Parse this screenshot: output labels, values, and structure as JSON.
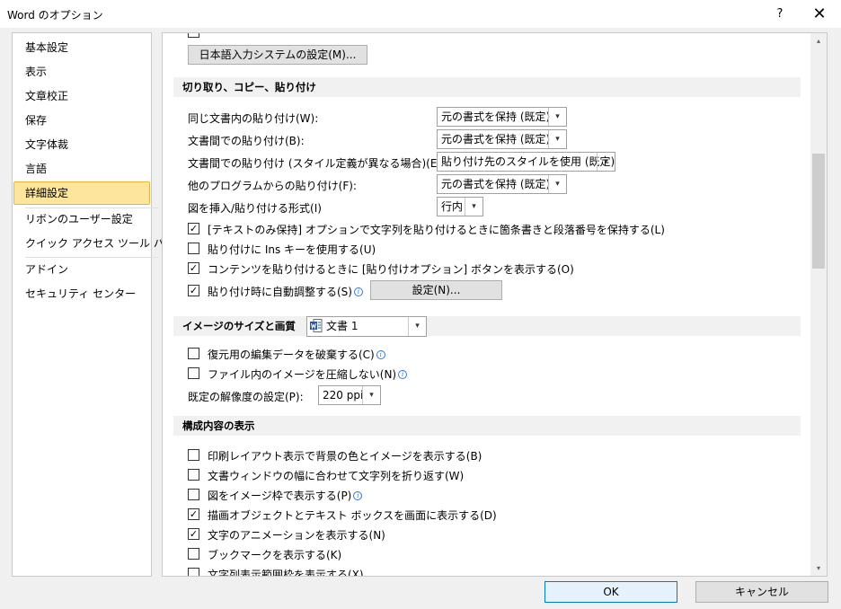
{
  "window": {
    "title": "Word のオプション",
    "help": "?",
    "close": "✕"
  },
  "sidebar": {
    "items": [
      {
        "label": "基本設定"
      },
      {
        "label": "表示"
      },
      {
        "label": "文章校正"
      },
      {
        "label": "保存"
      },
      {
        "label": "文字体裁"
      },
      {
        "label": "言語"
      },
      {
        "label": "詳細設定",
        "selected": true
      },
      {
        "label": "リボンのユーザー設定"
      },
      {
        "label": "クイック アクセス ツール バー"
      },
      {
        "label": "アドイン"
      },
      {
        "label": "セキュリティ センター"
      }
    ]
  },
  "top": {
    "ime_button": "日本語入力システムの設定(M)..."
  },
  "paste": {
    "header": "切り取り、コピー、貼り付け",
    "same_doc": {
      "label": "同じ文書内の貼り付け(W):",
      "value": "元の書式を保持 (既定)"
    },
    "between_docs": {
      "label": "文書間での貼り付け(B):",
      "value": "元の書式を保持 (既定)"
    },
    "between_docs_style": {
      "label": "文書間での貼り付け (スタイル定義が異なる場合)(E):",
      "value": "貼り付け先のスタイルを使用 (既定)"
    },
    "other_programs": {
      "label": "他のプログラムからの貼り付け(F):",
      "value": "元の書式を保持 (既定)"
    },
    "insert_image": {
      "label": "図を挿入/貼り付ける形式(I)",
      "value": "行内"
    },
    "keep_bullets": {
      "label": "[テキストのみ保持] オプションで文字列を貼り付けるときに箇条書きと段落番号を保持する(L)",
      "checked": true
    },
    "use_ins": {
      "label": "貼り付けに Ins キーを使用する(U)",
      "checked": false
    },
    "show_paste_options": {
      "label": "コンテンツを貼り付けるときに [貼り付けオプション] ボタンを表示する(O)",
      "checked": true
    },
    "smart_cut": {
      "label": "貼り付け時に自動調整する(S)",
      "checked": true
    },
    "settings_button": "設定(N)..."
  },
  "image": {
    "header": "イメージのサイズと画質",
    "doc_select": "文書 1",
    "discard_edit": {
      "label": "復元用の編集データを破棄する(C)",
      "checked": false
    },
    "no_compress": {
      "label": "ファイル内のイメージを圧縮しない(N)",
      "checked": false
    },
    "resolution": {
      "label": "既定の解像度の設定(P):",
      "value": "220 ppi"
    }
  },
  "display": {
    "header": "構成内容の表示",
    "items": [
      {
        "label": "印刷レイアウト表示で背景の色とイメージを表示する(B)",
        "checked": false
      },
      {
        "label": "文書ウィンドウの幅に合わせて文字列を折り返す(W)",
        "checked": false
      },
      {
        "label": "図をイメージ枠で表示する(P)",
        "checked": false
      },
      {
        "label": "描画オブジェクトとテキスト ボックスを画面に表示する(D)",
        "checked": true
      },
      {
        "label": "文字のアニメーションを表示する(N)",
        "checked": true
      },
      {
        "label": "ブックマークを表示する(K)",
        "checked": false
      },
      {
        "label": "文字列表示範囲枠を表示する(X)",
        "checked": false
      }
    ]
  },
  "footer": {
    "ok": "OK",
    "cancel": "キャンセル"
  },
  "glyphs": {
    "check": "✓",
    "arrow_down": "▾",
    "arrow_up": "▴"
  }
}
